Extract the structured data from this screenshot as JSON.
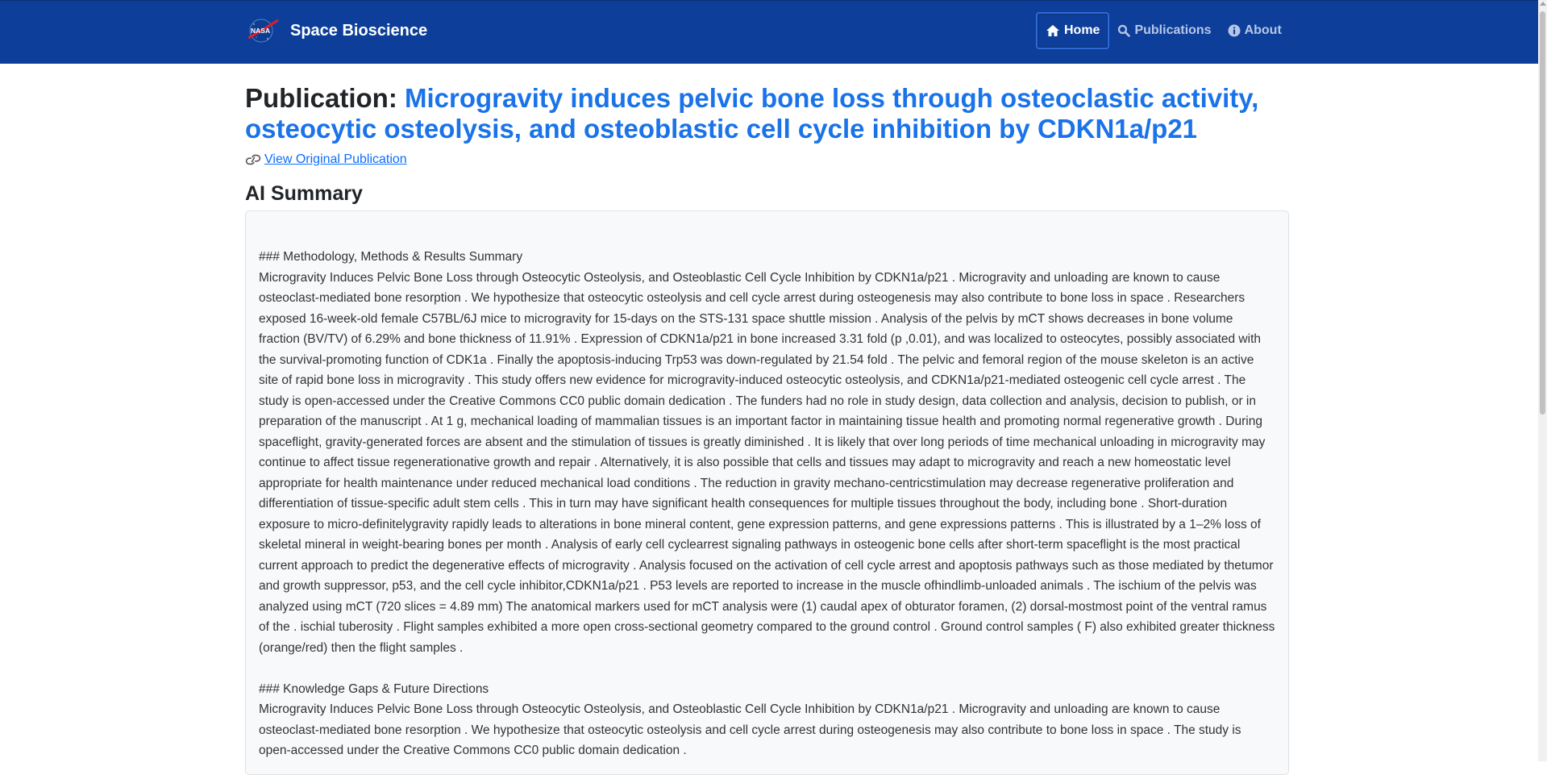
{
  "navbar": {
    "brand_title": "Space Bioscience",
    "links": [
      {
        "label": "Home",
        "icon": "home-icon",
        "active": true
      },
      {
        "label": "Publications",
        "icon": "search-icon",
        "active": false
      },
      {
        "label": "About",
        "icon": "info-icon",
        "active": false
      }
    ]
  },
  "page": {
    "title_prefix": "Publication: ",
    "title_text": "Microgravity induces pelvic bone loss through osteoclastic activity, osteocytic osteolysis, and osteoblastic cell cycle inhibition by CDKN1a/p21",
    "original_link": "View Original Publication",
    "section_title": "AI Summary"
  },
  "summary": {
    "heading_1": "### Methodology, Methods & Results Summary",
    "paragraph_1": "Microgravity Induces Pelvic Bone Loss through Osteocytic Osteolysis, and Osteoblastic Cell Cycle Inhibition by CDKN1a/p21 . Microgravity and unloading are known to cause osteoclast-mediated bone resorption . We hypothesize that osteocytic osteolysis and cell cycle arrest during osteogenesis may also contribute to bone loss in space . Researchers exposed 16-week-old female C57BL/6J mice to microgravity for 15-days on the STS-131 space shuttle mission . Analysis of the pelvis by mCT shows decreases in bone volume fraction (BV/TV) of 6.29% and bone thickness of 11.91% . Expression of CDKN1a/p21 in bone increased 3.31 fold (p ,0.01), and was localized to osteocytes, possibly associated with the survival-promoting function of CDK1a . Finally the apoptosis-inducing Trp53 was down-regulated by 21.54 fold . The pelvic and femoral region of the mouse skeleton is an active site of rapid bone loss in microgravity . This study offers new evidence for microgravity-induced osteocytic osteolysis, and CDKN1a/p21-mediated osteogenic cell cycle arrest . The study is open-accessed under the Creative Commons CC0 public domain dedication . The funders had no role in study design, data collection and analysis, decision to publish, or in preparation of the manuscript . At 1 g, mechanical loading of mammalian tissues is an important factor in maintaining tissue health and promoting normal regenerative growth . During spaceflight, gravity-generated forces are absent and the stimulation of tissues is greatly diminished . It is likely that over long periods of time mechanical unloading in microgravity may continue to affect tissue regenerationative growth and repair . Alternatively, it is also possible that cells and tissues may adapt to microgravity and reach a new homeostatic level appropriate for health maintenance under reduced mechanical load conditions . The reduction in gravity mechano-centricstimulation may decrease regenerative proliferation and differentiation of tissue-specific adult stem cells . This in turn may have significant health consequences for multiple tissues throughout the body, including bone . Short-duration exposure to micro-definitelygravity rapidly leads to alterations in bone mineral content, gene expression patterns, and gene expressions patterns . This is illustrated by a 1–2% loss of skeletal mineral in weight-bearing bones per month . Analysis of early cell cyclearrest signaling pathways in osteogenic bone cells after short-term spaceflight is the most practical current approach to predict the degenerative effects of microgravity . Analysis focused on the activation of cell cycle arrest and apoptosis pathways such as those mediated by thetumor and growth suppressor, p53, and the cell cycle inhibitor,CDKN1a/p21 . P53 levels are reported to increase in the muscle ofhindlimb-unloaded animals . The ischium of the pelvis was analyzed using mCT (720 slices = 4.89 mm) The anatomical markers used for mCT analysis were (1) caudal apex of obturator foramen, (2) dorsal-mostmost point of the ventral ramus of the . ischial tuberosity . Flight samples exhibited a more open cross-sectional geometry compared to the ground control . Ground control samples ( F) also exhibited greater thickness (orange/red) then the flight samples .",
    "heading_2": "### Knowledge Gaps & Future Directions",
    "paragraph_2": "Microgravity Induces Pelvic Bone Loss through Osteocytic Osteolysis, and Osteoblastic Cell Cycle Inhibition by CDKN1a/p21 . Microgravity and unloading are known to cause osteoclast-mediated bone resorption . We hypothesize that osteocytic osteolysis and cell cycle arrest during osteogenesis may also contribute to bone loss in space . The study is open-accessed under the Creative Commons CC0 public domain dedication ."
  },
  "colors": {
    "navbar_bg": "#0d3f9a",
    "title_link": "#1a73e8",
    "link": "#0d6efd",
    "summary_bg": "#f8f9fa"
  }
}
